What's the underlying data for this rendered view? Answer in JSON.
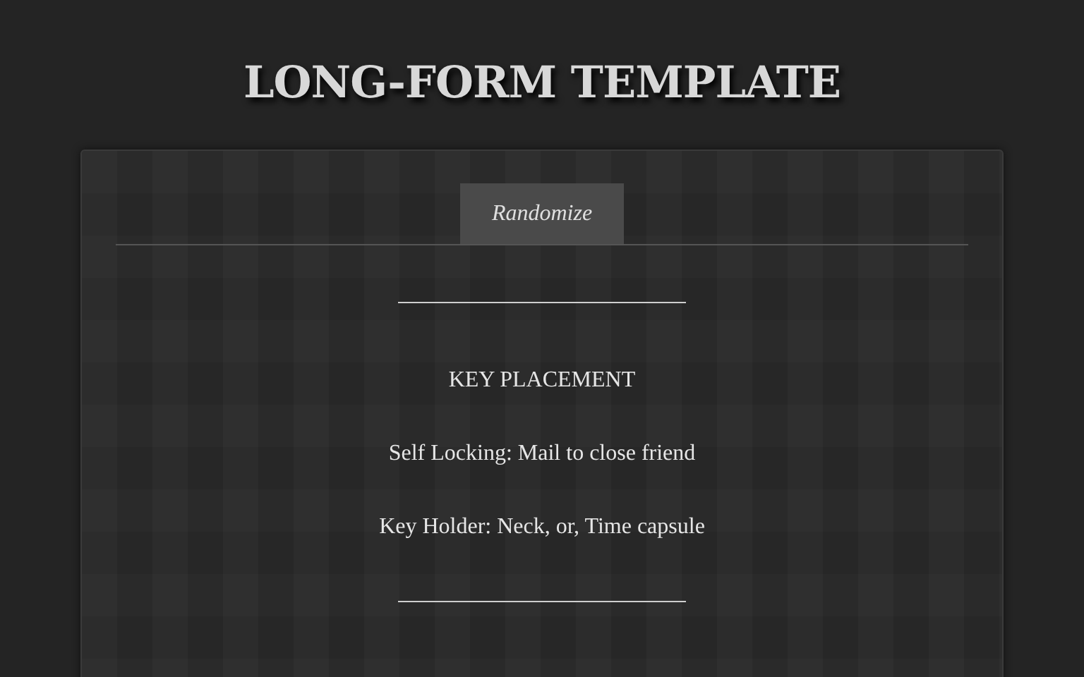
{
  "header": {
    "title": "LONG-FORM TEMPLATE"
  },
  "toolbar": {
    "button": "Randomize"
  },
  "content": {
    "heading": "KEY PLACEMENT",
    "lines": [
      "Self Locking: Mail to close friend",
      "Key Holder: Neck, or, Time capsule"
    ]
  }
}
